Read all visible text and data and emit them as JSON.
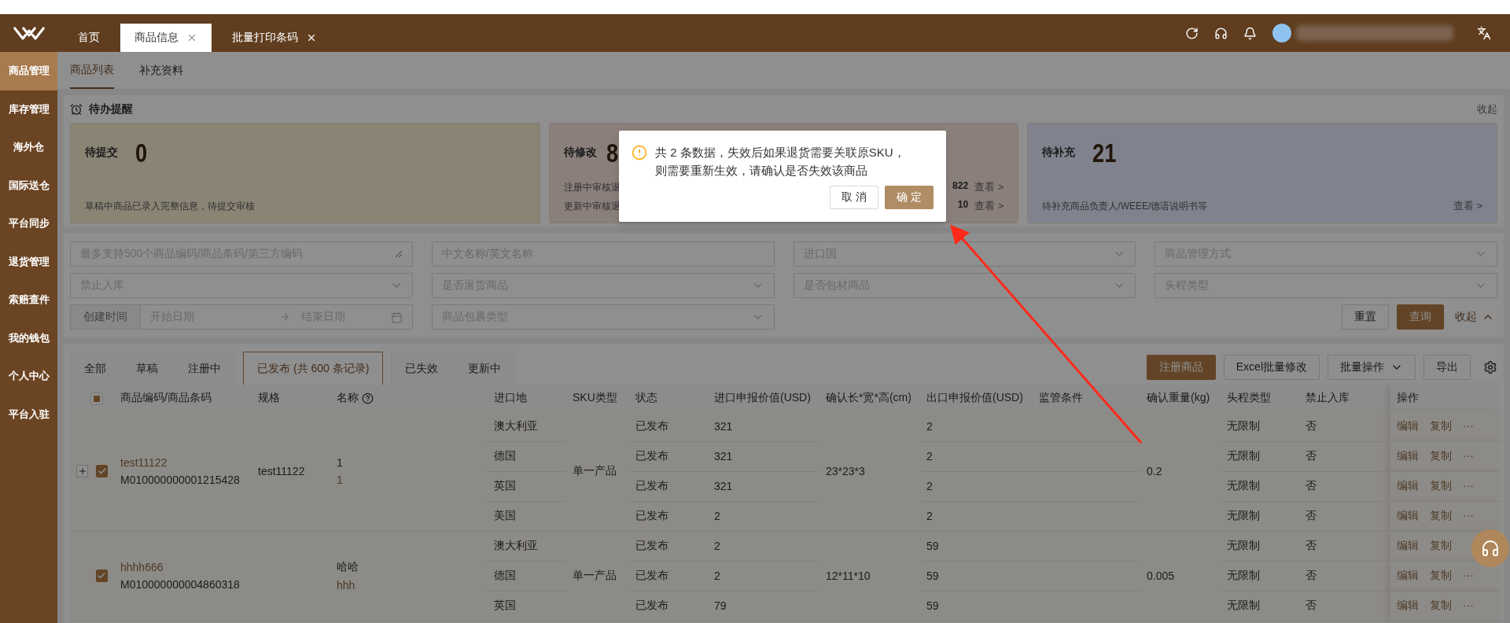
{
  "header": {
    "tabs": [
      {
        "label": "首页",
        "selected": false,
        "closable": false
      },
      {
        "label": "商品信息",
        "selected": true,
        "closable": true
      },
      {
        "label": "批量打印条码",
        "selected": false,
        "closable": true
      }
    ]
  },
  "sidebar": {
    "items": [
      {
        "label": "商品管理",
        "selected": true
      },
      {
        "label": "库存管理",
        "selected": false
      },
      {
        "label": "海外仓",
        "selected": false
      },
      {
        "label": "国际送仓",
        "selected": false
      },
      {
        "label": "平台同步",
        "selected": false
      },
      {
        "label": "退货管理",
        "selected": false
      },
      {
        "label": "索赔查件",
        "selected": false
      },
      {
        "label": "我的钱包",
        "selected": false
      },
      {
        "label": "个人中心",
        "selected": false
      },
      {
        "label": "平台入驻",
        "selected": false
      }
    ]
  },
  "subtabs": [
    {
      "label": "商品列表",
      "selected": true
    },
    {
      "label": "补充资料",
      "selected": false
    }
  ],
  "todo": {
    "title": "待办提醒",
    "collapse": "收起",
    "cards": [
      {
        "kind": "simple",
        "label": "待提交",
        "count": "0",
        "color": "#8a8475",
        "note": "草稿中商品已录入完整信息，待提交审核"
      },
      {
        "kind": "split",
        "label": "待修改",
        "count": "8",
        "color": "#8a7f7b",
        "lines": [
          {
            "text": "注册中审核退",
            "count": "822",
            "link": "查看 >"
          },
          {
            "text": "更新中审核退",
            "count": "10",
            "link": "查看 >"
          }
        ]
      },
      {
        "kind": "simple",
        "label": "待补充",
        "count": "21",
        "color": "#80828d",
        "note": "待补充商品负责人/WEEE/德语说明书等",
        "link": "查看 >"
      }
    ]
  },
  "filters": [
    {
      "kind": "textarea",
      "placeholder": "最多支持500个商品编码/商品条码/第三方编码"
    },
    {
      "kind": "input",
      "placeholder": "中文名称/英文名称"
    },
    {
      "kind": "select",
      "placeholder": "进口国"
    },
    {
      "kind": "select",
      "placeholder": "商品管理方式"
    },
    {
      "kind": "select",
      "placeholder": "禁止入库"
    },
    {
      "kind": "select",
      "placeholder": "是否退货商品"
    },
    {
      "kind": "select",
      "placeholder": "是否包材商品"
    },
    {
      "kind": "select",
      "placeholder": "头程类型"
    },
    {
      "kind": "daterange",
      "label": "创建时间",
      "start_placeholder": "开始日期",
      "end_placeholder": "结束日期"
    },
    {
      "kind": "select",
      "placeholder": "商品包裹类型"
    }
  ],
  "filter_actions": {
    "reset": "重置",
    "search": "查询",
    "collapse": "收起"
  },
  "status_tabs": [
    {
      "label": "全部",
      "selected": false
    },
    {
      "label": "草稿",
      "selected": false
    },
    {
      "label": "注册中",
      "selected": false
    },
    {
      "label": "已发布 (共 600 条记录)",
      "selected": true
    },
    {
      "label": "已失效",
      "selected": false
    },
    {
      "label": "更新中",
      "selected": false
    }
  ],
  "toolbar": [
    {
      "kind": "primary",
      "label": "注册商品"
    },
    {
      "kind": "default",
      "label": "Excel批量修改"
    },
    {
      "kind": "dropdown",
      "label": "批量操作"
    },
    {
      "kind": "default",
      "label": "导出"
    }
  ],
  "table": {
    "select_all_indeterminate": true,
    "columns": [
      {
        "label": "商品编码/商品条码",
        "help": false
      },
      {
        "label": "规格",
        "help": false
      },
      {
        "label": "名称",
        "help": true
      },
      {
        "label": "进口地",
        "help": false
      },
      {
        "label": "SKU类型",
        "help": false
      },
      {
        "label": "状态",
        "help": false
      },
      {
        "label": "进口申报价值(USD)",
        "help": false
      },
      {
        "label": "确认长*宽*高(cm)",
        "help": false
      },
      {
        "label": "出口申报价值(USD)",
        "help": false
      },
      {
        "label": "监管条件",
        "help": false
      },
      {
        "label": "确认重量(kg)",
        "help": false
      },
      {
        "label": "头程类型",
        "help": false
      },
      {
        "label": "禁止入库",
        "help": false
      },
      {
        "label": "操作",
        "help": false
      }
    ],
    "rows": [
      {
        "expandable": true,
        "checked": true,
        "code": "test11122",
        "barcode": "M010000000001215428",
        "spec": "test11122",
        "name": "1",
        "name_alt": "1",
        "sku_type": "单一产品",
        "dimensions": "23*23*3",
        "weight": "0.2",
        "variants": [
          {
            "origin": "澳大利亚",
            "status": "已发布",
            "import_value": "321",
            "export_value": "2",
            "freight_type": "无限制",
            "no_inbound": "否",
            "actions": [
              "编辑",
              "复制",
              "···"
            ]
          },
          {
            "origin": "德国",
            "status": "已发布",
            "import_value": "321",
            "export_value": "2",
            "freight_type": "无限制",
            "no_inbound": "否",
            "actions": [
              "编辑",
              "复制",
              "···"
            ]
          },
          {
            "origin": "英国",
            "status": "已发布",
            "import_value": "321",
            "export_value": "2",
            "freight_type": "无限制",
            "no_inbound": "否",
            "actions": [
              "编辑",
              "复制",
              "···"
            ]
          },
          {
            "origin": "美国",
            "status": "已发布",
            "import_value": "2",
            "export_value": "2",
            "freight_type": "无限制",
            "no_inbound": "否",
            "actions": [
              "编辑",
              "复制",
              "···"
            ]
          }
        ]
      },
      {
        "expandable": false,
        "checked": true,
        "code": "hhhh666",
        "barcode": "M010000000004860318",
        "name": "哈哈",
        "name_alt": "hhh",
        "sku_type": "单一产品",
        "dimensions": "12*11*10",
        "weight": "0.005",
        "variants": [
          {
            "origin": "澳大利亚",
            "status": "已发布",
            "import_value": "2",
            "export_value": "59",
            "freight_type": "无限制",
            "no_inbound": "否",
            "actions": [
              "编辑",
              "复制"
            ]
          },
          {
            "origin": "德国",
            "status": "已发布",
            "import_value": "2",
            "export_value": "59",
            "freight_type": "无限制",
            "no_inbound": "否",
            "actions": [
              "编辑",
              "复制",
              "···"
            ]
          },
          {
            "origin": "英国",
            "status": "已发布",
            "import_value": "79",
            "export_value": "59",
            "freight_type": "无限制",
            "no_inbound": "否",
            "actions": [
              "编辑",
              "复制",
              "···"
            ]
          }
        ]
      }
    ]
  },
  "dialog": {
    "message_lines": [
      "共 2 条数据，失效后如果退货需要关联原SKU，",
      "则需要重新生效，请确认是否失效该商品"
    ],
    "cancel": "取 消",
    "confirm": "确 定"
  }
}
